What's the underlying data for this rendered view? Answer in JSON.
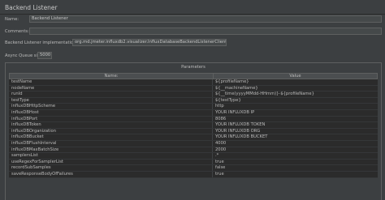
{
  "panel": {
    "title": "Backend Listener"
  },
  "name_field": {
    "label": "Name:",
    "value": "Backend Listener"
  },
  "comments_field": {
    "label": "Comments:",
    "value": ""
  },
  "implementation": {
    "label": "Backend Listener implementation",
    "value": "org.md.jmeter.influxdb2.visualizer.InfluxDatabaseBackendListenerClient"
  },
  "queue": {
    "label": "Async Queue size",
    "value": "5000"
  },
  "parameters": {
    "title": "Parameters",
    "columns": {
      "name": "Name:",
      "value": "Value"
    },
    "rows": [
      {
        "name": "testName",
        "value": "${profileName}"
      },
      {
        "name": "nodeName",
        "value": "${__machineName}"
      },
      {
        "name": "runId",
        "value": "${__time(yyyyMMdd-HHmm)}-${profileName}"
      },
      {
        "name": "testType",
        "value": "${testType}"
      },
      {
        "name": "influxDBHttpScheme",
        "value": "http"
      },
      {
        "name": "influxDBHost",
        "value": "YOUR INFLUXDB IP"
      },
      {
        "name": "influxDBPort",
        "value": "8086"
      },
      {
        "name": "influxDBToken",
        "value": "YOUR INFLUXDB TOKEN"
      },
      {
        "name": "influxDBOrganization",
        "value": "YOUR INFLUXDB ORG"
      },
      {
        "name": "influxDBBucket",
        "value": "YOUR INFLUXDB BUCKET"
      },
      {
        "name": "influxDBFlushInterval",
        "value": "4000"
      },
      {
        "name": "influxDBMaxBatchSize",
        "value": "2000"
      },
      {
        "name": "samplersList",
        "value": ".*"
      },
      {
        "name": "useRegexForSamplerList",
        "value": "true"
      },
      {
        "name": "recordSubSamples",
        "value": "false"
      },
      {
        "name": "saveResponseBodyOfFailures",
        "value": "true"
      }
    ]
  }
}
